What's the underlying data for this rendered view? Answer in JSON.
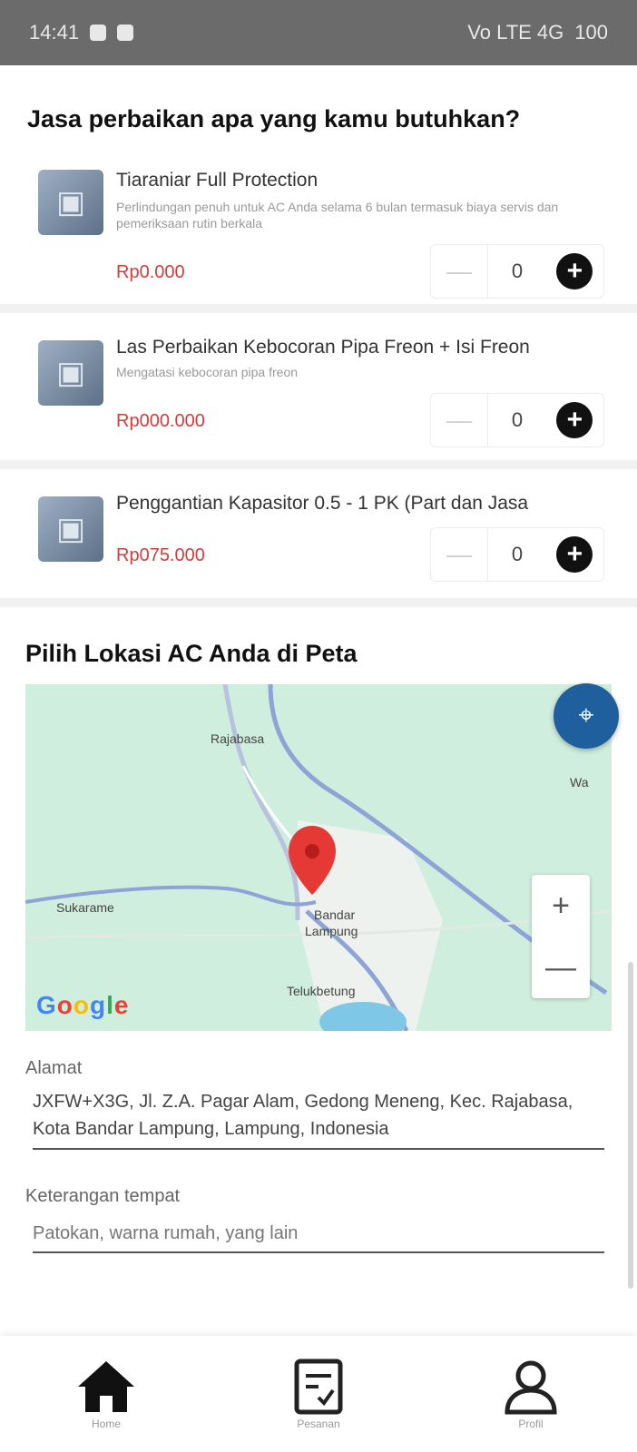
{
  "status_bar": {
    "time": "14:41",
    "right_text": "Vo LTE 4G",
    "battery": "100"
  },
  "services": {
    "title": "Jasa perbaikan apa yang kamu butuhkan?",
    "items": [
      {
        "name": "Tiaraniar Full Protection",
        "description": "Perlindungan penuh untuk AC Anda selama 6 bulan termasuk biaya servis dan pemeriksaan rutin berkala",
        "price": "Rp0.000",
        "qty": "0",
        "minus": "—",
        "plus": "+"
      },
      {
        "name": "Las Perbaikan Kebocoran Pipa Freon + Isi Freon",
        "description": "Mengatasi kebocoran pipa freon",
        "price": "Rp000.000",
        "qty": "0",
        "minus": "—",
        "plus": "+"
      },
      {
        "name": "Penggantian Kapasitor 0.5 - 1 PK (Part dan Jasa",
        "description": "",
        "price": "Rp075.000",
        "qty": "0",
        "minus": "—",
        "plus": "+"
      }
    ]
  },
  "map_section": {
    "title": "Pilih Lokasi AC Anda di Peta",
    "fab_icon": "locate-icon",
    "labels": {
      "top": "Rajabasa",
      "left": "Sukarame",
      "center_line1": "Bandar",
      "center_line2": "Lampung",
      "bottom": "Telukbetung",
      "right": "Wa"
    },
    "zoom_in": "+",
    "zoom_out": "—",
    "google_logo": "Google"
  },
  "address": {
    "label": "Alamat",
    "value": "JXFW+X3G, Jl. Z.A. Pagar Alam, Gedong Meneng, Kec. Rajabasa, Kota Bandar Lampung, Lampung, Indonesia"
  },
  "place_note": {
    "label": "Keterangan tempat",
    "placeholder": "Patokan, warna rumah, yang lain"
  },
  "bottom_nav": {
    "home": "Home",
    "orders": "Pesanan",
    "profile": "Profil"
  },
  "colors": {
    "price_red": "#d63b3b",
    "fab_blue": "#1f5f9e",
    "map_green": "#cfeedd"
  }
}
